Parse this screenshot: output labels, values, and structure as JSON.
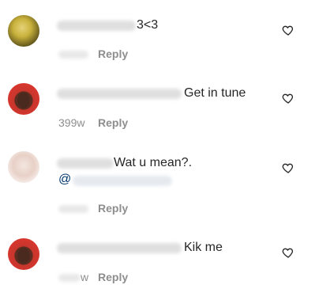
{
  "comments": [
    {
      "text": "3<3",
      "reply_label": "Reply",
      "time": "",
      "heart": "heart-outline-icon"
    },
    {
      "text": "Get in tune",
      "reply_label": "Reply",
      "time": "399w",
      "heart": "heart-outline-icon"
    },
    {
      "text": "Wat u mean?.",
      "mention_prefix": "@",
      "reply_label": "Reply",
      "time": "",
      "heart": "heart-outline-icon"
    },
    {
      "text": "Kik me",
      "reply_label": "Reply",
      "time": "w",
      "heart": "heart-outline-icon"
    }
  ]
}
